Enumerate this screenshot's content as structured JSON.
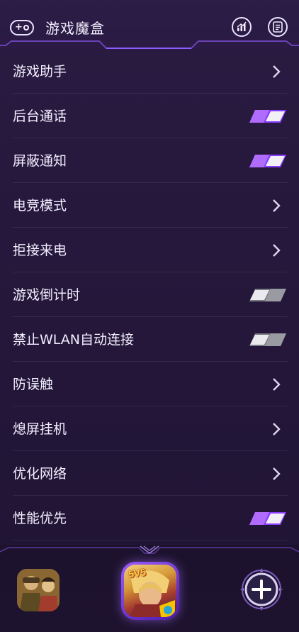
{
  "header": {
    "title": "游戏魔盒"
  },
  "settings": {
    "items": [
      {
        "label": "游戏助手",
        "control": "chevron"
      },
      {
        "label": "后台通话",
        "control": "toggle",
        "on": true
      },
      {
        "label": "屏蔽通知",
        "control": "toggle",
        "on": true
      },
      {
        "label": "电竞模式",
        "control": "chevron"
      },
      {
        "label": "拒接来电",
        "control": "chevron"
      },
      {
        "label": "游戏倒计时",
        "control": "toggle",
        "on": false
      },
      {
        "label": "禁止WLAN自动连接",
        "control": "toggle",
        "on": false
      },
      {
        "label": "防误触",
        "control": "chevron"
      },
      {
        "label": "熄屏挂机",
        "control": "chevron"
      },
      {
        "label": "优化网络",
        "control": "chevron"
      },
      {
        "label": "性能优先",
        "control": "toggle",
        "on": true
      }
    ]
  },
  "footer": {
    "game_badge": "5V5"
  },
  "colors": {
    "background": "#24173a",
    "toggle_on": "#9b4dff",
    "toggle_off": "#8e8e96",
    "text": "#f3efff"
  }
}
